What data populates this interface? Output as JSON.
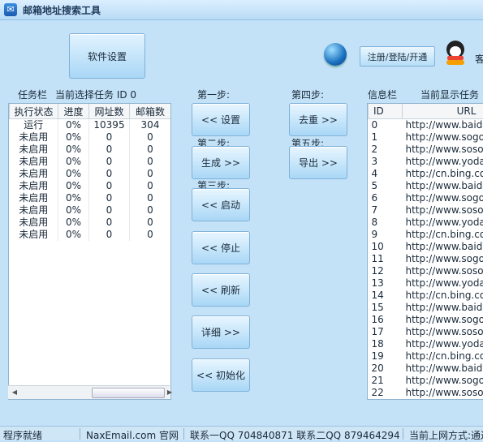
{
  "window": {
    "title": "邮箱地址搜索工具"
  },
  "toolbar": {
    "settings_label": "软件设置",
    "register_label": "注册/登陆/开通",
    "qq_label": "客"
  },
  "task_panel": {
    "title": "任务栏",
    "current_task": "当前选择任务 ID 0",
    "columns": [
      "执行状态",
      "进度",
      "网址数",
      "邮箱数"
    ],
    "rows": [
      [
        "运行",
        "0%",
        "10395",
        "304"
      ],
      [
        "未启用",
        "0%",
        "0",
        "0"
      ],
      [
        "未启用",
        "0%",
        "0",
        "0"
      ],
      [
        "未启用",
        "0%",
        "0",
        "0"
      ],
      [
        "未启用",
        "0%",
        "0",
        "0"
      ],
      [
        "未启用",
        "0%",
        "0",
        "0"
      ],
      [
        "未启用",
        "0%",
        "0",
        "0"
      ],
      [
        "未启用",
        "0%",
        "0",
        "0"
      ],
      [
        "未启用",
        "0%",
        "0",
        "0"
      ],
      [
        "未启用",
        "0%",
        "0",
        "0"
      ]
    ]
  },
  "steps": {
    "step1": "第一步:",
    "step2": "第二步:",
    "step3": "第三步:",
    "step4": "第四步:",
    "step5": "第五步:",
    "set": "<< 设置",
    "generate": "生成 >>",
    "start": "<< 启动",
    "stop": "<< 停止",
    "refresh": "<< 刷新",
    "detail": "详细 >>",
    "init": "<< 初始化",
    "dedupe": "去重 >>",
    "export": "导出 >>"
  },
  "info_panel": {
    "title": "信息栏",
    "current_display": "当前显示任务",
    "columns": [
      "ID",
      "URL"
    ],
    "rows": [
      [
        "0",
        "http://www.baidu"
      ],
      [
        "1",
        "http://www.sogo"
      ],
      [
        "2",
        "http://www.soso"
      ],
      [
        "3",
        "http://www.yoda"
      ],
      [
        "4",
        "http://cn.bing.co"
      ],
      [
        "5",
        "http://www.baidu"
      ],
      [
        "6",
        "http://www.sogo"
      ],
      [
        "7",
        "http://www.soso"
      ],
      [
        "8",
        "http://www.yoda"
      ],
      [
        "9",
        "http://cn.bing.co"
      ],
      [
        "10",
        "http://www.baidu"
      ],
      [
        "11",
        "http://www.sogo"
      ],
      [
        "12",
        "http://www.soso"
      ],
      [
        "13",
        "http://www.yoda"
      ],
      [
        "14",
        "http://cn.bing.co"
      ],
      [
        "15",
        "http://www.baidu"
      ],
      [
        "16",
        "http://www.sogo"
      ],
      [
        "17",
        "http://www.soso"
      ],
      [
        "18",
        "http://www.yoda"
      ],
      [
        "19",
        "http://cn.bing.co"
      ],
      [
        "20",
        "http://www.baidu"
      ],
      [
        "21",
        "http://www.sogo"
      ],
      [
        "22",
        "http://www.soso"
      ]
    ]
  },
  "status": {
    "ready": "程序就绪",
    "site": "NaxEmail.com 官网",
    "contact": "联系一QQ 704840871 联系二QQ 879464294",
    "net": "当前上网方式:通过"
  }
}
